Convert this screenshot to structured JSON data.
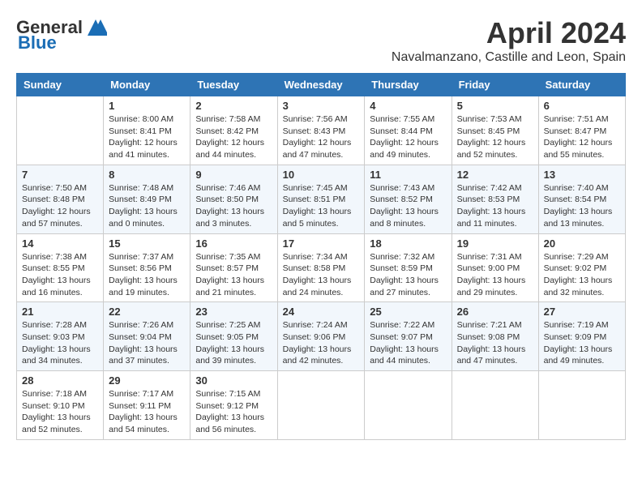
{
  "header": {
    "logo_general": "General",
    "logo_blue": "Blue",
    "month_title": "April 2024",
    "location": "Navalmanzano, Castille and Leon, Spain"
  },
  "days_of_week": [
    "Sunday",
    "Monday",
    "Tuesday",
    "Wednesday",
    "Thursday",
    "Friday",
    "Saturday"
  ],
  "weeks": [
    [
      {
        "day": "",
        "info": ""
      },
      {
        "day": "1",
        "info": "Sunrise: 8:00 AM\nSunset: 8:41 PM\nDaylight: 12 hours\nand 41 minutes."
      },
      {
        "day": "2",
        "info": "Sunrise: 7:58 AM\nSunset: 8:42 PM\nDaylight: 12 hours\nand 44 minutes."
      },
      {
        "day": "3",
        "info": "Sunrise: 7:56 AM\nSunset: 8:43 PM\nDaylight: 12 hours\nand 47 minutes."
      },
      {
        "day": "4",
        "info": "Sunrise: 7:55 AM\nSunset: 8:44 PM\nDaylight: 12 hours\nand 49 minutes."
      },
      {
        "day": "5",
        "info": "Sunrise: 7:53 AM\nSunset: 8:45 PM\nDaylight: 12 hours\nand 52 minutes."
      },
      {
        "day": "6",
        "info": "Sunrise: 7:51 AM\nSunset: 8:47 PM\nDaylight: 12 hours\nand 55 minutes."
      }
    ],
    [
      {
        "day": "7",
        "info": "Sunrise: 7:50 AM\nSunset: 8:48 PM\nDaylight: 12 hours\nand 57 minutes."
      },
      {
        "day": "8",
        "info": "Sunrise: 7:48 AM\nSunset: 8:49 PM\nDaylight: 13 hours\nand 0 minutes."
      },
      {
        "day": "9",
        "info": "Sunrise: 7:46 AM\nSunset: 8:50 PM\nDaylight: 13 hours\nand 3 minutes."
      },
      {
        "day": "10",
        "info": "Sunrise: 7:45 AM\nSunset: 8:51 PM\nDaylight: 13 hours\nand 5 minutes."
      },
      {
        "day": "11",
        "info": "Sunrise: 7:43 AM\nSunset: 8:52 PM\nDaylight: 13 hours\nand 8 minutes."
      },
      {
        "day": "12",
        "info": "Sunrise: 7:42 AM\nSunset: 8:53 PM\nDaylight: 13 hours\nand 11 minutes."
      },
      {
        "day": "13",
        "info": "Sunrise: 7:40 AM\nSunset: 8:54 PM\nDaylight: 13 hours\nand 13 minutes."
      }
    ],
    [
      {
        "day": "14",
        "info": "Sunrise: 7:38 AM\nSunset: 8:55 PM\nDaylight: 13 hours\nand 16 minutes."
      },
      {
        "day": "15",
        "info": "Sunrise: 7:37 AM\nSunset: 8:56 PM\nDaylight: 13 hours\nand 19 minutes."
      },
      {
        "day": "16",
        "info": "Sunrise: 7:35 AM\nSunset: 8:57 PM\nDaylight: 13 hours\nand 21 minutes."
      },
      {
        "day": "17",
        "info": "Sunrise: 7:34 AM\nSunset: 8:58 PM\nDaylight: 13 hours\nand 24 minutes."
      },
      {
        "day": "18",
        "info": "Sunrise: 7:32 AM\nSunset: 8:59 PM\nDaylight: 13 hours\nand 27 minutes."
      },
      {
        "day": "19",
        "info": "Sunrise: 7:31 AM\nSunset: 9:00 PM\nDaylight: 13 hours\nand 29 minutes."
      },
      {
        "day": "20",
        "info": "Sunrise: 7:29 AM\nSunset: 9:02 PM\nDaylight: 13 hours\nand 32 minutes."
      }
    ],
    [
      {
        "day": "21",
        "info": "Sunrise: 7:28 AM\nSunset: 9:03 PM\nDaylight: 13 hours\nand 34 minutes."
      },
      {
        "day": "22",
        "info": "Sunrise: 7:26 AM\nSunset: 9:04 PM\nDaylight: 13 hours\nand 37 minutes."
      },
      {
        "day": "23",
        "info": "Sunrise: 7:25 AM\nSunset: 9:05 PM\nDaylight: 13 hours\nand 39 minutes."
      },
      {
        "day": "24",
        "info": "Sunrise: 7:24 AM\nSunset: 9:06 PM\nDaylight: 13 hours\nand 42 minutes."
      },
      {
        "day": "25",
        "info": "Sunrise: 7:22 AM\nSunset: 9:07 PM\nDaylight: 13 hours\nand 44 minutes."
      },
      {
        "day": "26",
        "info": "Sunrise: 7:21 AM\nSunset: 9:08 PM\nDaylight: 13 hours\nand 47 minutes."
      },
      {
        "day": "27",
        "info": "Sunrise: 7:19 AM\nSunset: 9:09 PM\nDaylight: 13 hours\nand 49 minutes."
      }
    ],
    [
      {
        "day": "28",
        "info": "Sunrise: 7:18 AM\nSunset: 9:10 PM\nDaylight: 13 hours\nand 52 minutes."
      },
      {
        "day": "29",
        "info": "Sunrise: 7:17 AM\nSunset: 9:11 PM\nDaylight: 13 hours\nand 54 minutes."
      },
      {
        "day": "30",
        "info": "Sunrise: 7:15 AM\nSunset: 9:12 PM\nDaylight: 13 hours\nand 56 minutes."
      },
      {
        "day": "",
        "info": ""
      },
      {
        "day": "",
        "info": ""
      },
      {
        "day": "",
        "info": ""
      },
      {
        "day": "",
        "info": ""
      }
    ]
  ]
}
